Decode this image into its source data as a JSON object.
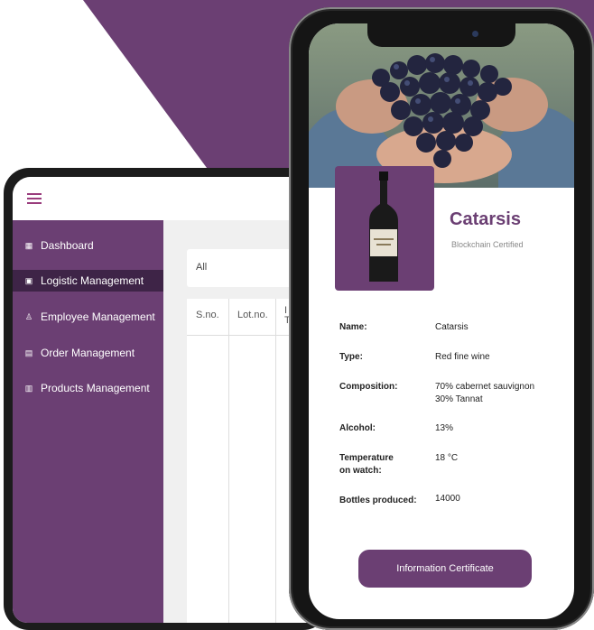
{
  "colors": {
    "brand_purple": "#6b3f73",
    "sidebar_active": "#3e2447",
    "accent_pink": "#9a3d7d"
  },
  "tablet": {
    "menu_icon": "hamburger-icon",
    "sidebar": {
      "items": [
        {
          "label": "Dashboard",
          "icon": "grid-icon",
          "active": false
        },
        {
          "label": "Logistic Management",
          "icon": "truck-icon",
          "active": true
        },
        {
          "label": "Employee Management",
          "icon": "user-icon",
          "active": false
        },
        {
          "label": "Order Management",
          "icon": "document-icon",
          "active": false
        },
        {
          "label": "Products Management",
          "icon": "box-icon",
          "active": false
        }
      ]
    },
    "filter": {
      "value": "All"
    },
    "table": {
      "columns": [
        "S.no.",
        "Lot.no.",
        "I T"
      ]
    }
  },
  "phone": {
    "product": {
      "name": "Catarsis",
      "certification": "Blockchain Certified"
    },
    "details": [
      {
        "label": "Name:",
        "value": "Catarsis"
      },
      {
        "label": "Type:",
        "value": "Red fine wine"
      },
      {
        "label": "Composition:",
        "value": "70% cabernet sauvignon\n30% Tannat"
      },
      {
        "label": "Alcohol:",
        "value": "13%"
      },
      {
        "label": "Temperature\non watch:",
        "value": "18 °C"
      },
      {
        "label": "Bottles produced:",
        "value": "14000"
      }
    ],
    "cta_label": "Information Certificate"
  }
}
